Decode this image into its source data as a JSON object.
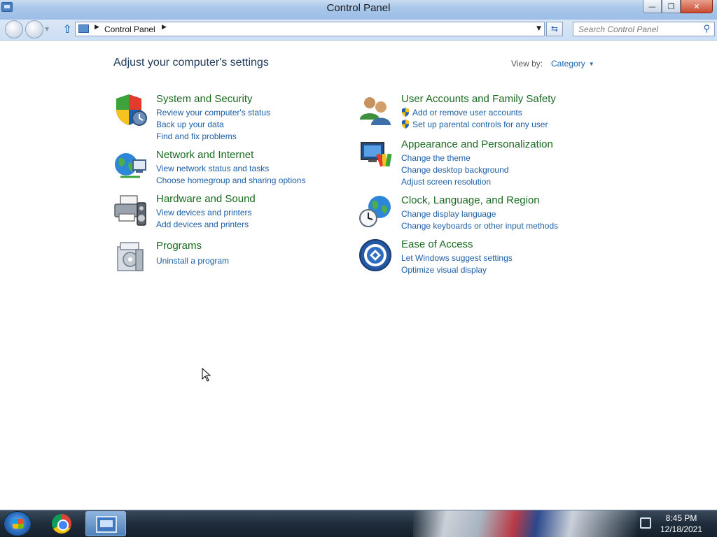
{
  "window": {
    "title": "Control Panel",
    "minimize_label": "—",
    "restore_label": "❐",
    "close_label": "✕"
  },
  "navigation": {
    "breadcrumb": "Control Panel",
    "search_placeholder": "Search Control Panel"
  },
  "main": {
    "heading": "Adjust your computer's settings",
    "view_by_label": "View by:",
    "view_by_value": "Category"
  },
  "categories": [
    {
      "title": "System and Security",
      "icon": "shield-icon",
      "links": [
        "Review your computer's status",
        "Back up your data",
        "Find and fix problems"
      ]
    },
    {
      "title": "Network and Internet",
      "icon": "network-globe-icon",
      "links": [
        "View network status and tasks",
        "Choose homegroup and sharing options"
      ]
    },
    {
      "title": "Hardware and Sound",
      "icon": "printer-speaker-icon",
      "links": [
        "View devices and printers",
        "Add devices and printers"
      ]
    },
    {
      "title": "Programs",
      "icon": "programs-box-icon",
      "links": [
        "Uninstall a program"
      ]
    },
    {
      "title": "User Accounts and Family Safety",
      "icon": "users-icon",
      "links": [
        "Add or remove user accounts",
        "Set up parental controls for any user"
      ]
    },
    {
      "title": "Appearance and Personalization",
      "icon": "monitor-palette-icon",
      "links": [
        "Change the theme",
        "Change desktop background",
        "Adjust screen resolution"
      ]
    },
    {
      "title": "Clock, Language, and Region",
      "icon": "clock-globe-icon",
      "links": [
        "Change display language",
        "Change keyboards or other input methods"
      ]
    },
    {
      "title": "Ease of Access",
      "icon": "ease-of-access-icon",
      "links": [
        "Let Windows suggest settings",
        "Optimize visual display"
      ]
    }
  ],
  "taskbar": {
    "time": "8:45 PM",
    "date": "12/18/2021"
  }
}
